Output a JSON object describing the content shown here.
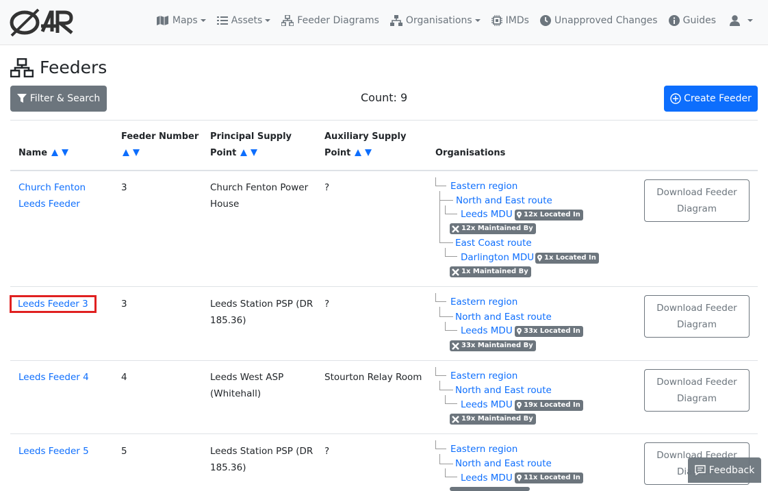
{
  "nav": {
    "items": [
      {
        "label": "Maps",
        "icon": "map-icon",
        "dropdown": true
      },
      {
        "label": "Assets",
        "icon": "list-icon",
        "dropdown": true
      },
      {
        "label": "Feeder Diagrams",
        "icon": "sitemap-icon",
        "dropdown": false
      },
      {
        "label": "Organisations",
        "icon": "org-icon",
        "dropdown": true
      },
      {
        "label": "IMDs",
        "icon": "chip-icon",
        "dropdown": false
      },
      {
        "label": "Unapproved Changes",
        "icon": "clock-icon",
        "dropdown": false
      },
      {
        "label": "Guides",
        "icon": "info-icon",
        "dropdown": false
      }
    ]
  },
  "page": {
    "title": "Feeders",
    "filter_label": "Filter & Search",
    "count": "Count: 9",
    "create_label": "Create Feeder"
  },
  "table": {
    "headers": {
      "name": "Name",
      "feeder_number_1": "Feeder Number",
      "psp_1": "Principal Supply",
      "psp_2": "Point",
      "asp_1": "Auxiliary Supply",
      "asp_2": "Point",
      "orgs": "Organisations"
    },
    "download_l1": "Download Feeder",
    "download_l2": "Diagram",
    "rows": [
      {
        "name_1": "Church Fenton",
        "name_2": "Leeds Feeder",
        "number": "3",
        "psp_1": "Church Fenton Power",
        "psp_2": "House",
        "asp": "?",
        "org": {
          "region": "Eastern region",
          "route1": "North and East route",
          "mdu1": "Leeds MDU",
          "mdu1_located": "12x Located In",
          "mdu1_maint": "12x Maintained By",
          "route2": "East Coast route",
          "mdu2": "Darlington MDU",
          "mdu2_located": "1x Located In",
          "mdu2_maint": "1x Maintained By"
        }
      },
      {
        "name_1": "Leeds Feeder 3",
        "number": "3",
        "psp_1": "Leeds Station PSP (DR",
        "psp_2": "185.36)",
        "asp": "?",
        "org": {
          "region": "Eastern region",
          "route1": "North and East route",
          "mdu1": "Leeds MDU",
          "mdu1_located": "33x Located In",
          "mdu1_maint": "33x Maintained By"
        }
      },
      {
        "name_1": "Leeds Feeder 4",
        "number": "4",
        "psp_1": "Leeds West ASP",
        "psp_2": "(Whitehall)",
        "asp": "Stourton Relay Room",
        "org": {
          "region": "Eastern region",
          "route1": "North and East route",
          "mdu1": "Leeds MDU",
          "mdu1_located": "19x Located In",
          "mdu1_maint": "19x Maintained By"
        }
      },
      {
        "name_1": "Leeds Feeder 5",
        "number": "5",
        "psp_1": "Leeds Station PSP (DR",
        "psp_2": "185.36)",
        "asp": "?",
        "org": {
          "region": "Eastern region",
          "route1": "North and East route",
          "mdu1": "Leeds MDU",
          "mdu1_located": "11x Located In"
        }
      }
    ]
  },
  "feedback_label": "Feedback",
  "colors": {
    "primary": "#0d6efd",
    "secondary": "#6c757d",
    "highlight": "#e02020"
  }
}
